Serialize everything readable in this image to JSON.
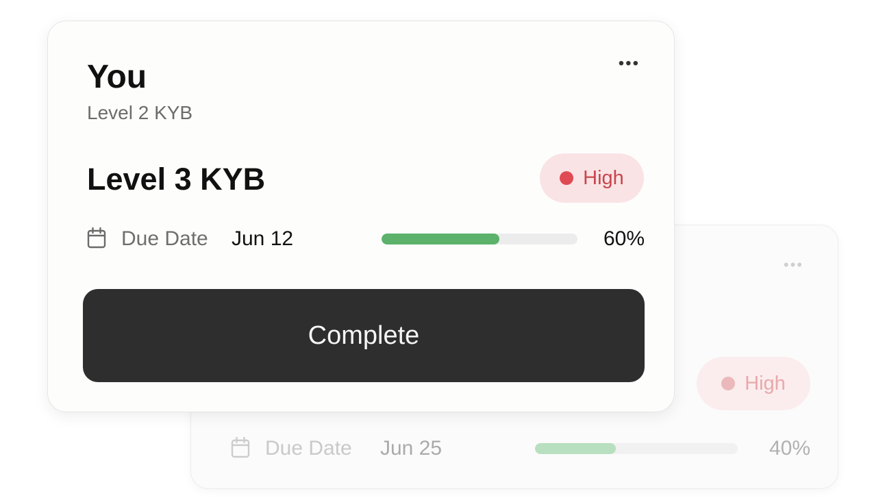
{
  "back_card": {
    "menu_label": "•••",
    "priority": {
      "label": "High",
      "color": "#ebb9bb"
    },
    "due_date_label": "Due Date",
    "due_date_value": "Jun 25",
    "progress": {
      "value": 0.4,
      "label": "40%",
      "color": "#b8dfbf"
    },
    "icons": {
      "menu": "more-horizontal-icon",
      "calendar": "calendar-icon"
    }
  },
  "front_card": {
    "menu_label": "•••",
    "owner": "You",
    "previous_level": "Level 2 KYB",
    "task_title": "Level 3 KYB",
    "priority": {
      "label": "High",
      "color": "#e04b53"
    },
    "due_date_label": "Due Date",
    "due_date_value": "Jun 12",
    "progress": {
      "value": 0.6,
      "label": "60%",
      "color": "#5cb26a"
    },
    "action_label": "Complete",
    "icons": {
      "menu": "more-horizontal-icon",
      "calendar": "calendar-icon"
    }
  }
}
